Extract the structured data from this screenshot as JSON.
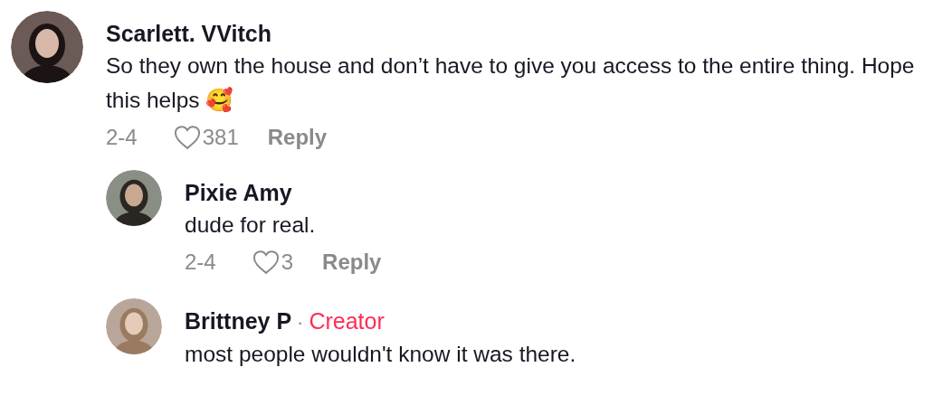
{
  "comments": [
    {
      "author": "Scarlett. VVitch",
      "text": "So they own the house and don’t have to give you access to the entire thing. Hope this helps 🥰",
      "date": "2-4",
      "likes": "381",
      "reply": "Reply",
      "replies": [
        {
          "author": "Pixie Amy",
          "text": "dude for real.",
          "date": "2-4",
          "likes": "3",
          "reply": "Reply"
        },
        {
          "author": "Brittney P",
          "separator": "·",
          "badge": "Creator",
          "text": "most people wouldn't know it was there."
        }
      ]
    }
  ]
}
